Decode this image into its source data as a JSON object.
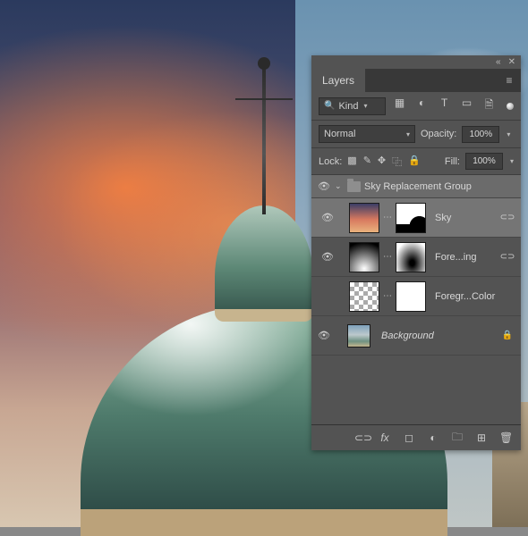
{
  "panel": {
    "title": "Layers",
    "filter_kind": "Kind",
    "blend_mode": "Normal",
    "opacity_label": "Opacity:",
    "opacity_value": "100%",
    "lock_label": "Lock:",
    "fill_label": "Fill:",
    "fill_value": "100%"
  },
  "layers": {
    "group": "Sky Replacement Group",
    "sky": "Sky",
    "foreground_lighting": "Fore...ing",
    "foreground_color": "Foregr...Color",
    "background": "Background"
  }
}
